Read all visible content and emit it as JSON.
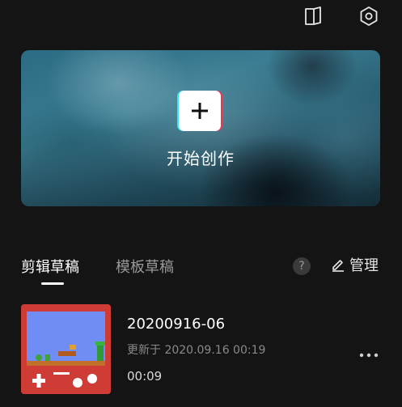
{
  "topbar": {
    "tutorial_icon": "book-icon",
    "settings_icon": "settings-hexagon-icon"
  },
  "hero": {
    "create_icon": "plus-icon",
    "create_label": "开始创作"
  },
  "tabs": {
    "active_label": "剪辑草稿",
    "inactive_label": "模板草稿",
    "help_glyph": "?",
    "manage_label": "管理",
    "manage_icon": "edit-pencil-icon"
  },
  "drafts": [
    {
      "title": "20200916-06",
      "updated": "更新于 2020.09.16 00:19",
      "duration": "00:09",
      "more_icon": "more-dots-icon"
    }
  ],
  "colors": {
    "background": "#141414",
    "tab_active": "#ffffff",
    "tab_inactive": "#9a9a9a",
    "glitch_cyan": "#38e5ec",
    "glitch_red": "#f0334f"
  }
}
